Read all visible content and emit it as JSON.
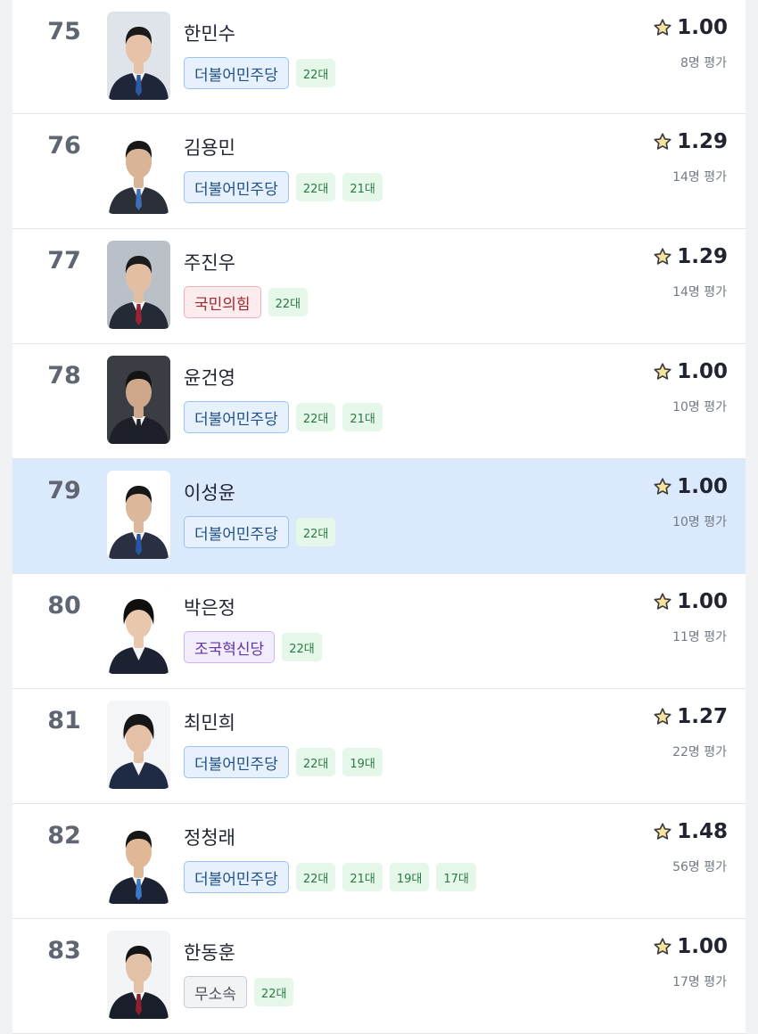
{
  "rows": [
    {
      "rank": "75",
      "name": "한민수",
      "party": "더불어민주당",
      "party_style": "blue",
      "terms": [
        "22대"
      ],
      "score": "1.00",
      "count": "8명 평가",
      "selected": false,
      "photo": {
        "bg": "#dfe3ea",
        "suit": "#1e2638",
        "tie": "#2d5aa6",
        "hair": "#1a1a1a",
        "skin": "#e6c3a8",
        "female": false
      }
    },
    {
      "rank": "76",
      "name": "김용민",
      "party": "더불어민주당",
      "party_style": "blue",
      "terms": [
        "22대",
        "21대"
      ],
      "score": "1.29",
      "count": "14명 평가",
      "selected": false,
      "photo": {
        "bg": "#ffffff",
        "suit": "#2b2f38",
        "tie": "#3e6fb8",
        "hair": "#181818",
        "skin": "#d9b497",
        "female": false
      }
    },
    {
      "rank": "77",
      "name": "주진우",
      "party": "국민의힘",
      "party_style": "red",
      "terms": [
        "22대"
      ],
      "score": "1.29",
      "count": "14명 평가",
      "selected": false,
      "photo": {
        "bg": "#b9c0c8",
        "suit": "#242a36",
        "tie": "#9b2332",
        "hair": "#1c1c1c",
        "skin": "#e2bfa3",
        "female": false
      }
    },
    {
      "rank": "78",
      "name": "윤건영",
      "party": "더불어민주당",
      "party_style": "blue",
      "terms": [
        "22대",
        "21대"
      ],
      "score": "1.00",
      "count": "10명 평가",
      "selected": false,
      "photo": {
        "bg": "#3a3d44",
        "suit": "#1d2029",
        "tie": "#1d2029",
        "hair": "#141414",
        "skin": "#cfa88c",
        "female": false
      }
    },
    {
      "rank": "79",
      "name": "이성윤",
      "party": "더불어민주당",
      "party_style": "blue",
      "terms": [
        "22대"
      ],
      "score": "1.00",
      "count": "10명 평가",
      "selected": true,
      "photo": {
        "bg": "#ffffff",
        "suit": "#2a3042",
        "tie": "#2756a8",
        "hair": "#161616",
        "skin": "#dcb79b",
        "female": false
      }
    },
    {
      "rank": "80",
      "name": "박은정",
      "party": "조국혁신당",
      "party_style": "purple",
      "terms": [
        "22대"
      ],
      "score": "1.00",
      "count": "11명 평가",
      "selected": false,
      "photo": {
        "bg": "#ffffff",
        "suit": "#1c2232",
        "tie": "#ffffff",
        "hair": "#0f0f0f",
        "skin": "#e8c7ad",
        "female": true
      }
    },
    {
      "rank": "81",
      "name": "최민희",
      "party": "더불어민주당",
      "party_style": "blue",
      "terms": [
        "22대",
        "19대"
      ],
      "score": "1.27",
      "count": "22명 평가",
      "selected": false,
      "photo": {
        "bg": "#f4f5f7",
        "suit": "#1f2a44",
        "tie": "#1f2a44",
        "hair": "#161616",
        "skin": "#e4c1a6",
        "female": true
      }
    },
    {
      "rank": "82",
      "name": "정청래",
      "party": "더불어민주당",
      "party_style": "blue",
      "terms": [
        "22대",
        "21대",
        "19대",
        "17대"
      ],
      "score": "1.48",
      "count": "56명 평가",
      "selected": false,
      "photo": {
        "bg": "#ffffff",
        "suit": "#1d2233",
        "tie": "#3a78c9",
        "hair": "#161616",
        "skin": "#e1b896",
        "female": false
      }
    },
    {
      "rank": "83",
      "name": "한동훈",
      "party": "무소속",
      "party_style": "gray",
      "terms": [
        "22대"
      ],
      "score": "1.00",
      "count": "17명 평가",
      "selected": false,
      "photo": {
        "bg": "#f3f4f6",
        "suit": "#1a1e2a",
        "tie": "#8e1f2f",
        "hair": "#141414",
        "skin": "#e3c1a6",
        "female": false
      }
    }
  ],
  "star_icon": "star-icon",
  "colors": {
    "star_fill": "#f7e3a0",
    "star_stroke": "#3b3b3b",
    "selected_bg": "#dbe9fc"
  }
}
